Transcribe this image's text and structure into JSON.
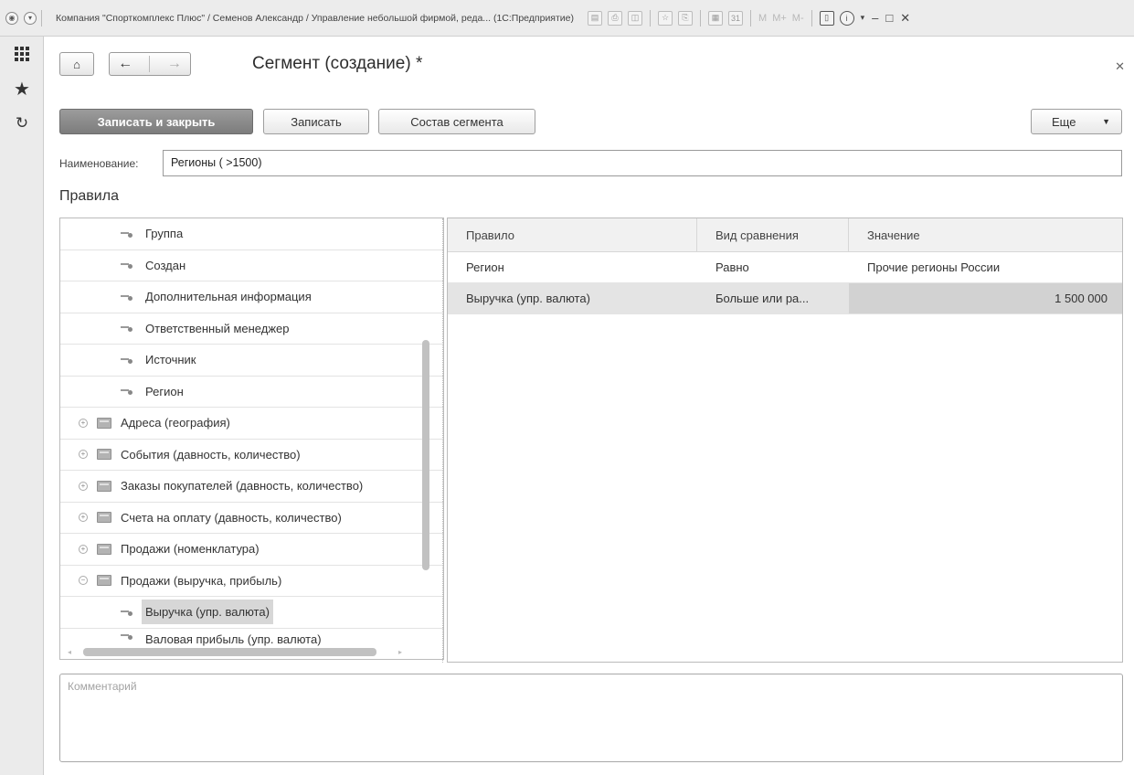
{
  "window": {
    "title": "Компания \"Спорткомплекс Плюс\" / Семенов Александр / Управление небольшой фирмой, реда... (1С:Предприятие)",
    "toolbar_text": [
      "M",
      "M+",
      "M-"
    ]
  },
  "form": {
    "title": "Сегмент (создание) *"
  },
  "commands": {
    "save_close": "Записать и закрыть",
    "save": "Записать",
    "segment_composition": "Состав сегмента",
    "more": "Еще"
  },
  "name_field": {
    "label": "Наименование:",
    "value": "Регионы ( >1500)"
  },
  "rules_section": {
    "title": "Правила"
  },
  "tree": {
    "items": [
      {
        "label": "Группа",
        "kind": "field"
      },
      {
        "label": "Создан",
        "kind": "field"
      },
      {
        "label": "Дополнительная информация",
        "kind": "field"
      },
      {
        "label": "Ответственный менеджер",
        "kind": "field"
      },
      {
        "label": "Источник",
        "kind": "field"
      },
      {
        "label": "Регион",
        "kind": "field"
      },
      {
        "label": "Адреса (география)",
        "kind": "folder",
        "expanded": false
      },
      {
        "label": "События (давность, количество)",
        "kind": "folder",
        "expanded": false
      },
      {
        "label": "Заказы покупателей (давность, количество)",
        "kind": "folder",
        "expanded": false
      },
      {
        "label": "Счета на оплату (давность, количество)",
        "kind": "folder",
        "expanded": false
      },
      {
        "label": "Продажи (номенклатура)",
        "kind": "folder",
        "expanded": false
      },
      {
        "label": "Продажи (выручка, прибыль)",
        "kind": "folder",
        "expanded": true
      },
      {
        "label": "Выручка (упр. валюта)",
        "kind": "field",
        "selected": true
      },
      {
        "label": "Валовая прибыль (упр. валюта)",
        "kind": "field"
      }
    ]
  },
  "rules_table": {
    "columns": [
      "Правило",
      "Вид сравнения",
      "Значение"
    ],
    "rows": [
      {
        "rule": "Регион",
        "comparison": "Равно",
        "value": "Прочие регионы России"
      },
      {
        "rule": "Выручка (упр. валюта)",
        "comparison": "Больше или ра...",
        "value": "1 500 000"
      }
    ]
  },
  "comment": {
    "placeholder": "Комментарий"
  },
  "icons": {
    "sidebar": [
      "apps-grid-icon",
      "favorites-star-icon",
      "history-icon"
    ],
    "nav": [
      "home-icon",
      "back-arrow-icon",
      "forward-arrow-icon"
    ]
  }
}
